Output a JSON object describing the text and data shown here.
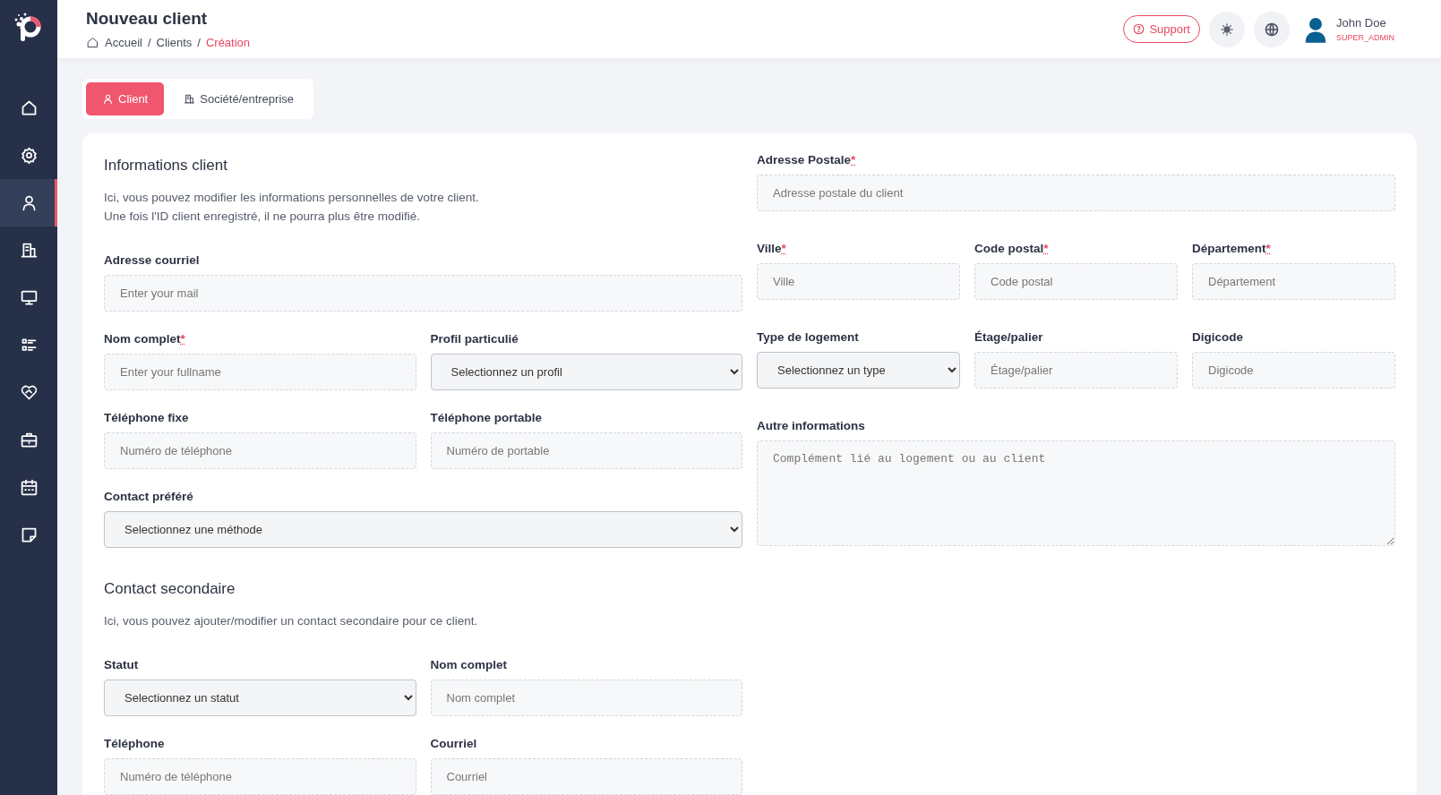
{
  "sidebar": {
    "items": [
      {
        "kind": "home",
        "selected": false
      },
      {
        "kind": "gear",
        "selected": false
      },
      {
        "kind": "user",
        "selected": true
      },
      {
        "kind": "building",
        "selected": false
      },
      {
        "kind": "monitor",
        "selected": false
      },
      {
        "kind": "list",
        "selected": false
      },
      {
        "kind": "heart",
        "selected": false
      },
      {
        "kind": "briefcase",
        "selected": false
      },
      {
        "kind": "calendar",
        "selected": false
      },
      {
        "kind": "note",
        "selected": false
      }
    ]
  },
  "header": {
    "title": "Nouveau client",
    "breadcrumb": [
      {
        "label": "Accueil",
        "current": false
      },
      {
        "label": "Clients",
        "current": false
      },
      {
        "label": "Création",
        "current": true
      }
    ],
    "breadcrumb_separator": "/",
    "support": "Support",
    "user": {
      "name": "John Doe",
      "role": "SUPER_ADMIN"
    }
  },
  "tabs": [
    {
      "label": "Client",
      "kind": "user",
      "selected": true
    },
    {
      "label": "Société/entreprise",
      "kind": "building",
      "selected": false
    }
  ],
  "required_marker": "*",
  "left": [
    {
      "title": "Informations client",
      "description": [
        "Ici, vous pouvez modifier les informations personnelles de votre client.",
        "Une fois l'ID client enregistré, il ne pourra plus être modifié."
      ],
      "rows": [
        [
          {
            "kind": "input",
            "label": "Adresse courriel",
            "required": false,
            "placeholder": "Enter your mail"
          }
        ],
        [
          {
            "kind": "input",
            "label": "Nom complet",
            "required": true,
            "placeholder": "Enter your fullname"
          },
          {
            "kind": "select",
            "label": "Profil particulié",
            "required": false,
            "value": "Selectionnez un profil"
          }
        ],
        [
          {
            "kind": "input",
            "label": "Téléphone fixe",
            "required": false,
            "placeholder": "Numéro de téléphone"
          },
          {
            "kind": "input",
            "label": "Téléphone portable",
            "required": false,
            "placeholder": "Numéro de portable"
          }
        ],
        [
          {
            "kind": "select",
            "label": "Contact préféré",
            "required": false,
            "value": "Selectionnez une méthode"
          }
        ]
      ]
    },
    {
      "title": "Contact secondaire",
      "description": [
        "Ici, vous pouvez ajouter/modifier un contact secondaire pour ce client."
      ],
      "rows": [
        [
          {
            "kind": "select",
            "label": "Statut",
            "required": false,
            "value": "Selectionnez un statut"
          },
          {
            "kind": "input",
            "label": "Nom complet",
            "required": false,
            "placeholder": "Nom complet"
          }
        ],
        [
          {
            "kind": "input",
            "label": "Téléphone",
            "required": false,
            "placeholder": "Numéro de téléphone"
          },
          {
            "kind": "input",
            "label": "Courriel",
            "required": false,
            "placeholder": "Courriel"
          }
        ]
      ]
    }
  ],
  "right": {
    "rows": [
      [
        {
          "kind": "input",
          "label": "Adresse Postale",
          "required": true,
          "placeholder": "Adresse postale du client"
        }
      ],
      [
        {
          "kind": "input",
          "label": "Ville",
          "required": true,
          "placeholder": "Ville"
        },
        {
          "kind": "input",
          "label": "Code postal",
          "required": true,
          "placeholder": "Code postal"
        },
        {
          "kind": "input",
          "label": "Département",
          "required": true,
          "placeholder": "Département"
        }
      ],
      [
        {
          "kind": "select",
          "label": "Type de logement",
          "required": false,
          "value": "Selectionnez un type"
        },
        {
          "kind": "input",
          "label": "Étage/palier",
          "required": false,
          "placeholder": "Étage/palier"
        },
        {
          "kind": "input",
          "label": "Digicode",
          "required": false,
          "placeholder": "Digicode"
        }
      ],
      [
        {
          "kind": "textarea",
          "label": "Autre informations",
          "required": false,
          "placeholder": "Complément lié au logement ou au client"
        }
      ]
    ]
  }
}
